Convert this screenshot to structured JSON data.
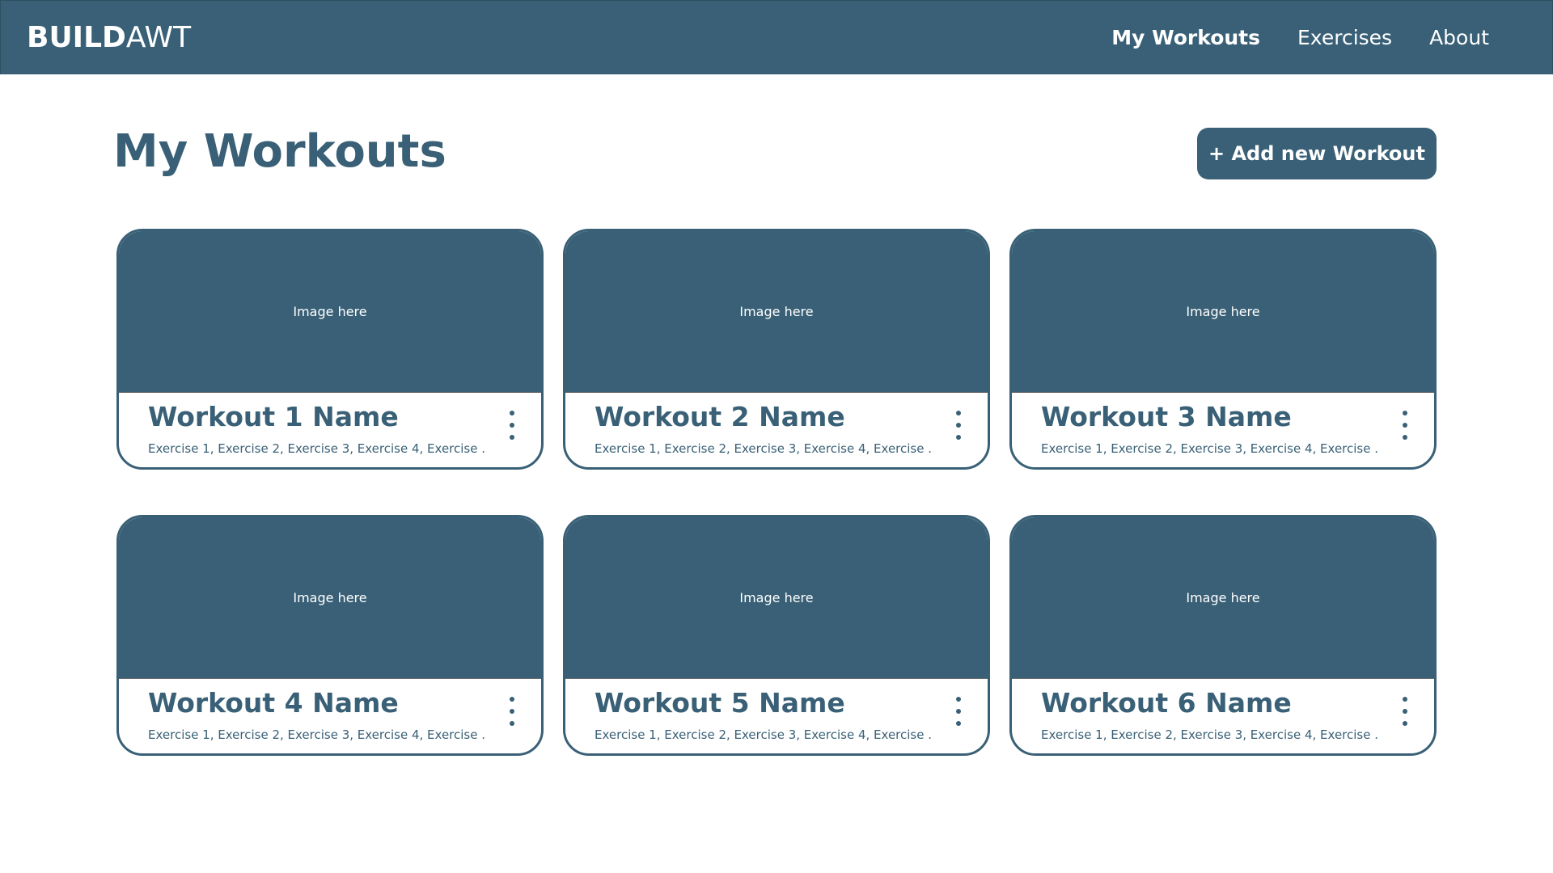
{
  "colors": {
    "primary": "#396076",
    "background": "#ffffff",
    "text_on_primary": "#ffffff"
  },
  "navbar": {
    "brand_bold": "BUILD",
    "brand_light": "AWT",
    "links": [
      {
        "label": "My Workouts",
        "active": true
      },
      {
        "label": "Exercises",
        "active": false
      },
      {
        "label": "About",
        "active": false
      }
    ]
  },
  "page": {
    "title": "My Workouts",
    "add_button_label": "+ Add new Workout"
  },
  "workouts": [
    {
      "image_label": "Image here",
      "name": "Workout 1 Name",
      "exercises": "Exercise 1, Exercise 2, Exercise 3, Exercise 4, Exercise ...",
      "menu_icon": "more-vertical-icon"
    },
    {
      "image_label": "Image here",
      "name": "Workout 2 Name",
      "exercises": "Exercise 1, Exercise 2, Exercise 3, Exercise 4, Exercise ...",
      "menu_icon": "more-vertical-icon"
    },
    {
      "image_label": "Image here",
      "name": "Workout 3 Name",
      "exercises": "Exercise 1, Exercise 2, Exercise 3, Exercise 4, Exercise ...",
      "menu_icon": "more-vertical-icon"
    },
    {
      "image_label": "Image here",
      "name": "Workout 4 Name",
      "exercises": "Exercise 1, Exercise 2, Exercise 3, Exercise 4, Exercise ...",
      "menu_icon": "more-vertical-icon"
    },
    {
      "image_label": "Image here",
      "name": "Workout 5 Name",
      "exercises": "Exercise 1, Exercise 2, Exercise 3, Exercise 4, Exercise ...",
      "menu_icon": "more-vertical-icon"
    },
    {
      "image_label": "Image here",
      "name": "Workout 6 Name",
      "exercises": "Exercise 1, Exercise 2, Exercise 3, Exercise 4, Exercise ...",
      "menu_icon": "more-vertical-icon"
    }
  ]
}
